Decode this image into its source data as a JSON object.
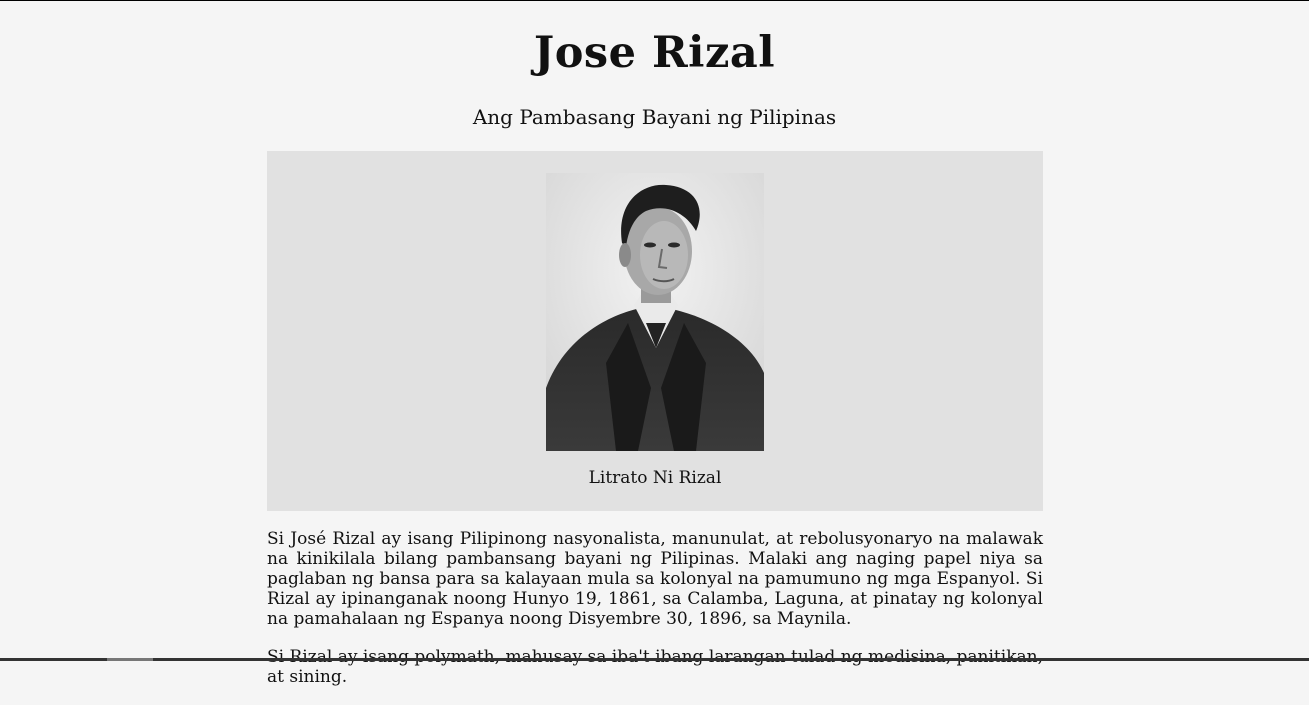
{
  "header": {
    "title": "Jose Rizal",
    "subtitle": "Ang Pambasang Bayani ng Pilipinas"
  },
  "figure": {
    "image_icon": "portrait-photo",
    "caption": "Litrato Ni Rizal"
  },
  "article": {
    "paragraphs": [
      "Si José Rizal ay isang Pilipinong nasyonalista, manunulat, at rebolusyonaryo na malawak na kinikilala bilang pambansang bayani ng Pilipinas. Malaki ang naging papel niya sa paglaban ng bansa para sa kalayaan mula sa kolonyal na pamumuno ng mga Espanyol. Si Rizal ay ipinanganak noong Hunyo 19, 1861, sa Calamba, Laguna, at pinatay ng kolonyal na pamahalaan ng Espanya noong Disyembre 30, 1896, sa Maynila.",
      "Si Rizal ay isang polymath, mahusay sa iba't ibang larangan tulad ng medisina, panitikan, at sining."
    ]
  }
}
